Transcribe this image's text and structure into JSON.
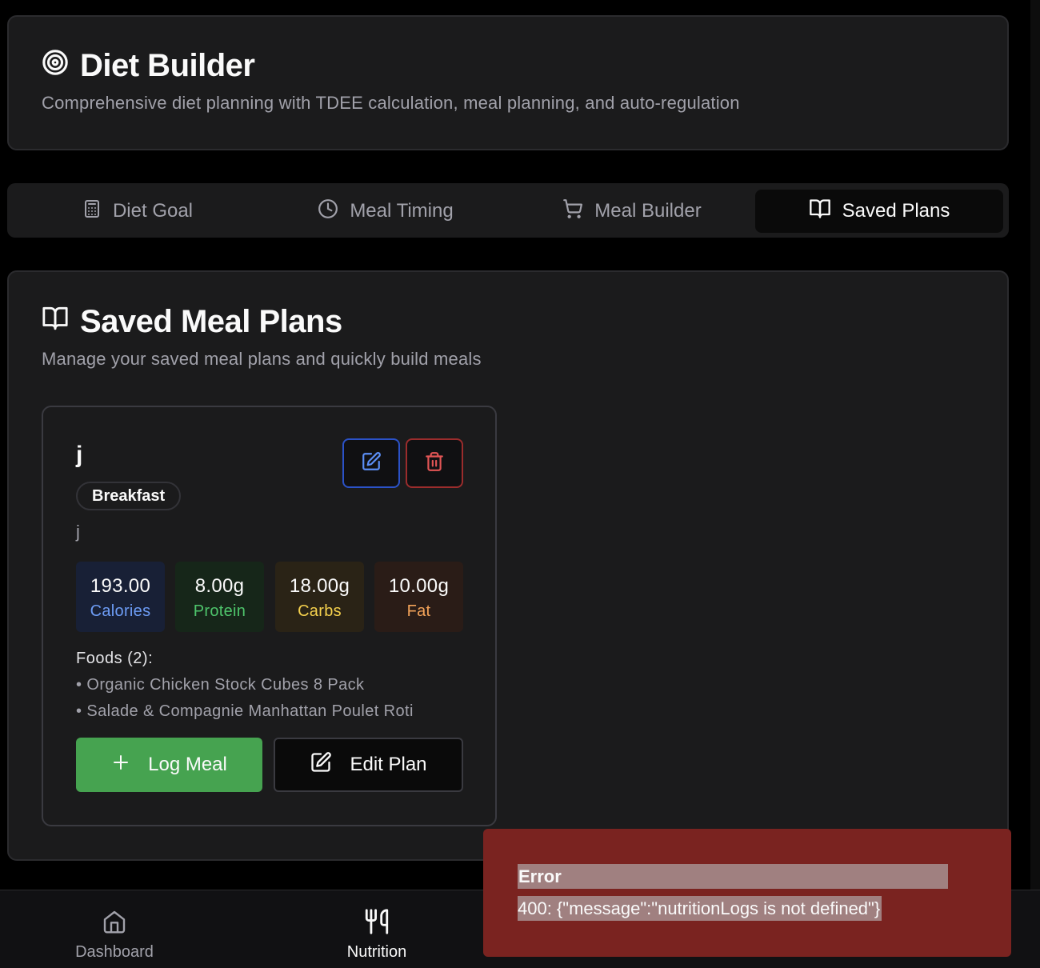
{
  "header": {
    "title": "Diet Builder",
    "subtitle": "Comprehensive diet planning with TDEE calculation, meal planning, and auto-regulation",
    "icon": "target-icon"
  },
  "tabs": [
    {
      "label": "Diet Goal",
      "icon": "calculator-icon",
      "active": false
    },
    {
      "label": "Meal Timing",
      "icon": "clock-icon",
      "active": false
    },
    {
      "label": "Meal Builder",
      "icon": "cart-icon",
      "active": false
    },
    {
      "label": "Saved Plans",
      "icon": "book-open-icon",
      "active": true
    }
  ],
  "section": {
    "title": "Saved Meal Plans",
    "subtitle": "Manage your saved meal plans and quickly build meals",
    "icon": "book-open-icon"
  },
  "plan": {
    "name": "j",
    "meal_type": "Breakfast",
    "description": "j",
    "macros": {
      "calories": {
        "value": "193.00",
        "label": "Calories"
      },
      "protein": {
        "value": "8.00g",
        "label": "Protein"
      },
      "carbs": {
        "value": "18.00g",
        "label": "Carbs"
      },
      "fat": {
        "value": "10.00g",
        "label": "Fat"
      }
    },
    "foods_title": "Foods (2):",
    "foods": [
      "• Organic Chicken Stock Cubes 8 Pack",
      "• Salade & Compagnie Manhattan Poulet Roti"
    ],
    "log_label": "Log Meal",
    "edit_label": "Edit Plan"
  },
  "bottom_nav": [
    {
      "label": "Dashboard",
      "icon": "home-icon",
      "active": false
    },
    {
      "label": "Nutrition",
      "icon": "utensils-icon",
      "active": true
    }
  ],
  "toast": {
    "title": "Error",
    "message": "400: {\"message\":\"nutritionLogs is not defined\"}"
  },
  "colors": {
    "accent_green": "#46a350",
    "calories_blue": "#6d9cf5",
    "protein_green": "#4ec46b",
    "carbs_yellow": "#f5d14d",
    "fat_orange": "#f2a259",
    "error_red": "#7a2320"
  }
}
